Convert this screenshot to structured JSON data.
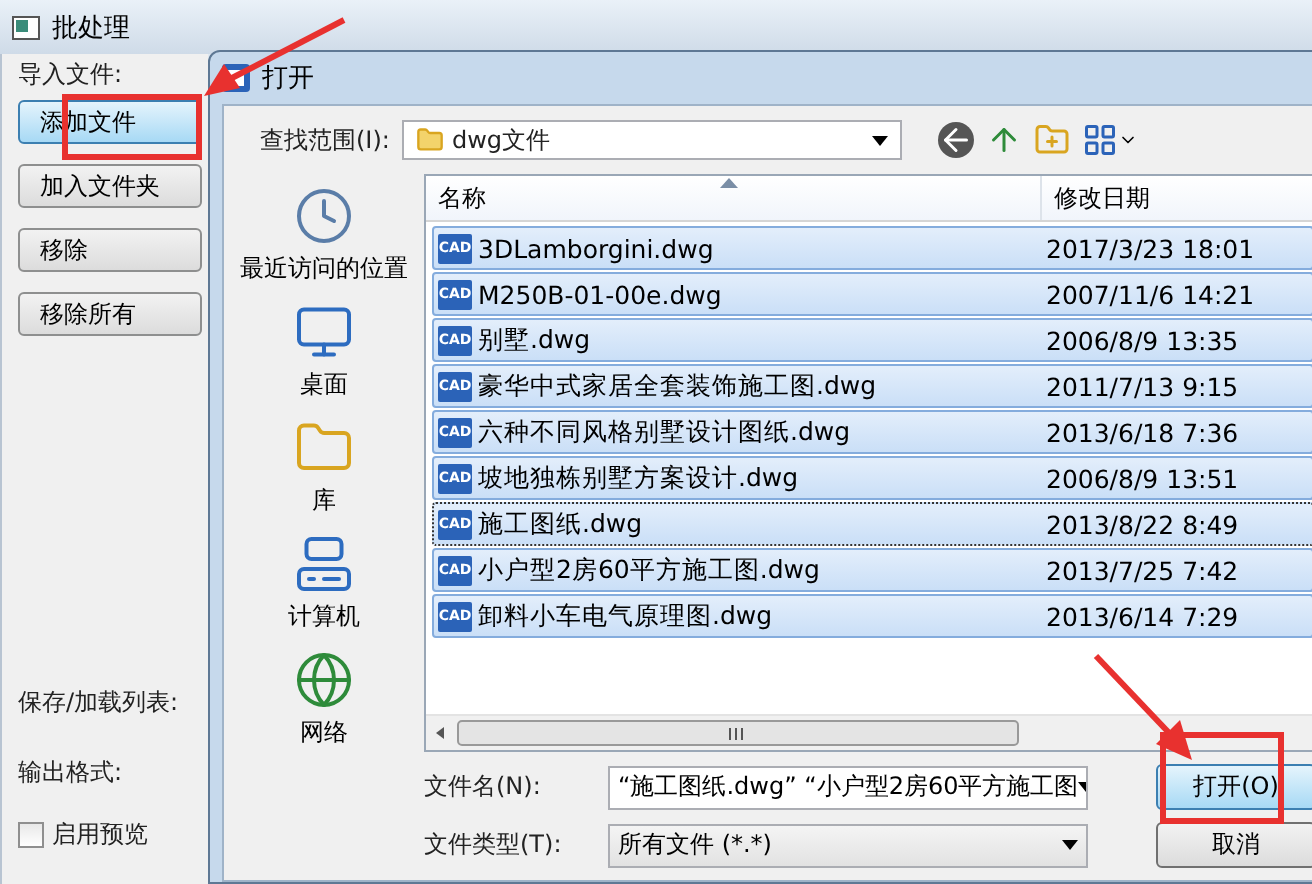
{
  "background_window": {
    "title": "批处理",
    "import_label": "导入文件:",
    "buttons": [
      {
        "label": "添加文件",
        "selected": true
      },
      {
        "label": "加入文件夹",
        "selected": false
      },
      {
        "label": "移除",
        "selected": false
      },
      {
        "label": "移除所有",
        "selected": false
      }
    ],
    "save_label": "保存/加载列表:",
    "output_label": "输出格式:",
    "preview_checkbox": {
      "label": "启用预览",
      "checked": false
    }
  },
  "dialog": {
    "title": "打开",
    "look_in_label": "查找范围(I):",
    "look_in_value": "dwg文件",
    "places": [
      {
        "label": "最近访问的位置",
        "kind": "recent"
      },
      {
        "label": "桌面",
        "kind": "desktop"
      },
      {
        "label": "库",
        "kind": "library"
      },
      {
        "label": "计算机",
        "kind": "computer"
      },
      {
        "label": "网络",
        "kind": "network"
      }
    ],
    "columns": [
      {
        "label": "名称",
        "sorted": true
      },
      {
        "label": "修改日期",
        "sorted": false
      }
    ],
    "files": [
      {
        "icon_label": "CAD",
        "name": "3DLamborgini.dwg",
        "modified": "2017/3/23 18:01",
        "selected": true,
        "focused": false
      },
      {
        "icon_label": "CAD",
        "name": "M250B-01-00e.dwg",
        "modified": "2007/11/6 14:21",
        "selected": true,
        "focused": false
      },
      {
        "icon_label": "CAD",
        "name": "别墅.dwg",
        "modified": "2006/8/9 13:35",
        "selected": true,
        "focused": false
      },
      {
        "icon_label": "CAD",
        "name": "豪华中式家居全套装饰施工图.dwg",
        "modified": "2011/7/13 9:15",
        "selected": true,
        "focused": false
      },
      {
        "icon_label": "CAD",
        "name": "六种不同风格别墅设计图纸.dwg",
        "modified": "2013/6/18 7:36",
        "selected": true,
        "focused": false
      },
      {
        "icon_label": "CAD",
        "name": "坡地独栋别墅方案设计.dwg",
        "modified": "2006/8/9 13:51",
        "selected": true,
        "focused": false
      },
      {
        "icon_label": "CAD",
        "name": "施工图纸.dwg",
        "modified": "2013/8/22 8:49",
        "selected": true,
        "focused": true
      },
      {
        "icon_label": "CAD",
        "name": "小户型2房60平方施工图.dwg",
        "modified": "2013/7/25 7:42",
        "selected": true,
        "focused": false
      },
      {
        "icon_label": "CAD",
        "name": "卸料小车电气原理图.dwg",
        "modified": "2013/6/14 7:29",
        "selected": true,
        "focused": false
      }
    ],
    "file_name_label": "文件名(N):",
    "file_name_value": "“施工图纸.dwg” “小户型2房60平方施工图",
    "file_type_label": "文件类型(T):",
    "file_type_value": "所有文件 (*.*)",
    "buttons": [
      {
        "label": "打开(O)",
        "kind": "primary"
      },
      {
        "label": "取消",
        "kind": "normal"
      }
    ]
  }
}
